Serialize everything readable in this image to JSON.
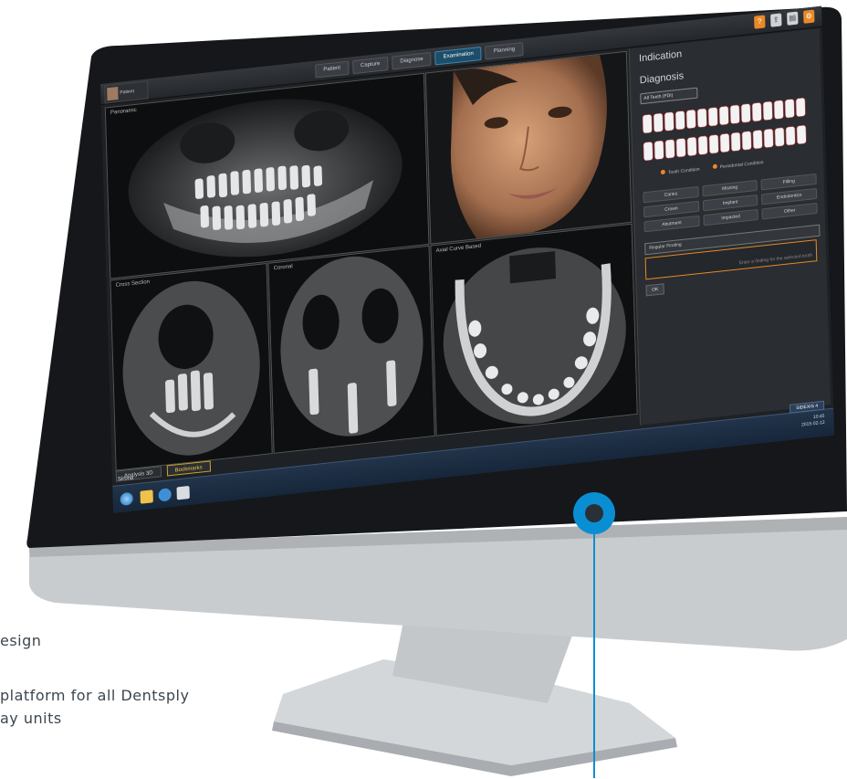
{
  "caption": {
    "line1": "esign",
    "line2a": "platform for all Dentsply",
    "line2b": "ay units"
  },
  "app": {
    "patient_label": "Patient",
    "tabs": [
      {
        "label": "Patient",
        "active": false
      },
      {
        "label": "Capture",
        "active": false
      },
      {
        "label": "Diagnose",
        "active": false
      },
      {
        "label": "Examination",
        "active": true
      },
      {
        "label": "Planning",
        "active": false
      }
    ],
    "viewports": {
      "pano": "Panoramic",
      "sagittal": "Cross Section",
      "coronal": "Coronal",
      "axial": "Axial Curve Based"
    },
    "bottom_tabs": [
      {
        "label": "Analysis 3D",
        "selected": false
      },
      {
        "label": "Bookmarks",
        "selected": true
      }
    ],
    "side": {
      "indication_title": "Indication",
      "diagnosis_title": "Diagnosis",
      "dropdown": "All Teeth (FDI)",
      "legend": [
        "Tooth Condition",
        "Periodontal Condition"
      ],
      "buttons": [
        "Caries",
        "Missing",
        "Filling",
        "Crown",
        "Implant",
        "Endodontics",
        "Abutment",
        "Impacted",
        "Other"
      ],
      "select": "Regular Finding",
      "textarea_hint": "Enter a finding for the selected tooth",
      "ok": "OK"
    },
    "taskbar": {
      "label": "Sirona",
      "tray_button": "SIDEXIS 4",
      "time": "10:45",
      "date": "2015-02-12"
    }
  },
  "colors": {
    "accent": "#0a8ed3",
    "active_tab": "#1d4d69",
    "orange": "#e88a27"
  }
}
